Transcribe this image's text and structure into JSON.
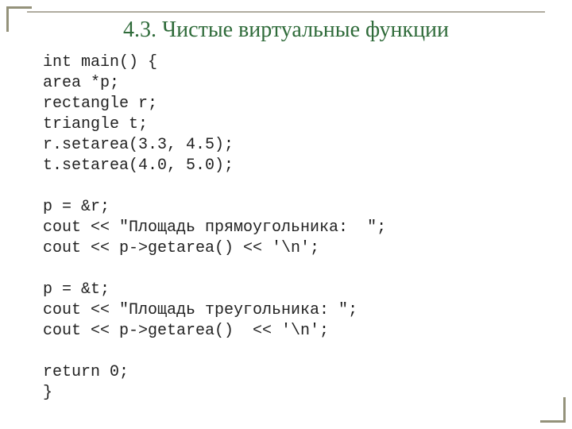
{
  "title": "4.3. Чистые виртуальные функции",
  "code": "int main() {\narea *p;\nrectangle r;\ntriangle t;\nr.setarea(3.3, 4.5);\nt.setarea(4.0, 5.0);\n\np = &r;\ncout << \"Площадь прямоугольника:  \";\ncout << p->getarea() << '\\n';\n\np = &t;\ncout << \"Площадь треугольника: \";\ncout << p->getarea()  << '\\n';\n\nreturn 0;\n}"
}
